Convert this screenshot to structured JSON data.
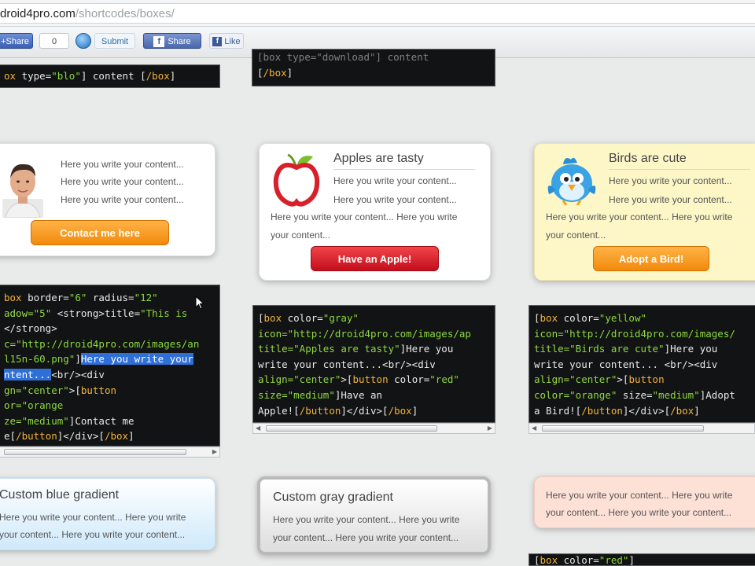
{
  "browser": {
    "url_host": "droid4pro.com",
    "url_path": "/shortcodes/boxes/"
  },
  "social": {
    "share": "+Share",
    "count": "0",
    "submit": "Submit",
    "fb_share": "Share",
    "like": "Like",
    "fb_glyph": "f"
  },
  "code_top_left": {
    "tag_open": "ox",
    "attr": " type=",
    "value": "\"blo\"",
    "content": "] content [",
    "tag_close": "/box",
    "end": "]"
  },
  "code_top_middle": {
    "line1": "[box type=\"download\"] content",
    "tag_open": "[",
    "tag_close": "/box",
    "end": "]"
  },
  "box_person": {
    "line1": "Here you write your content...",
    "line2": "Here you write your content...",
    "line3": "Here you write your content...",
    "button": "Contact me here"
  },
  "box_apple": {
    "title": "Apples are tasty",
    "line1": "Here you write your content...",
    "line2": "Here you write your content...",
    "line3": "Here you write your content... Here you write",
    "line4": "your content...",
    "button": "Have an Apple!"
  },
  "box_bird": {
    "title": "Birds are cute",
    "line1": "Here you write your content...",
    "line2": "Here you write your content...",
    "line3": "Here you write your content... Here you write",
    "line4": "your content...",
    "button": "Adopt a Bird!"
  },
  "code_left": {
    "l1a": "box",
    "l1b": " border=",
    "l1c": "\"6\"",
    "l1d": " radius=",
    "l1e": "\"12\"",
    "l2a": "adow=",
    "l2b": "\"5\"",
    "l2c": " <strong>title=",
    "l2d": "\"This is",
    "l3": "</strong>",
    "l4a": "c=",
    "l4b": "\"http://droid4pro.com/images/an",
    "l5a": "l15n-60.png\"",
    "l5b": "]",
    "l5c": "Here you write your",
    "l6a": "ntent...",
    "l6b": "<br/><div",
    "l7a": "gn=",
    "l7b": "\"center\"",
    "l7c": ">[",
    "l7d": "button",
    "l8a": "or=",
    "l8b": "\"orange",
    "l9a": "ze=",
    "l9b": "\"medium\"",
    "l9c": "]Contact me",
    "l10a": "e[",
    "l10b": "/button",
    "l10c": "]</div>[",
    "l10d": "/box",
    "l10e": "]"
  },
  "code_middle": {
    "l1a": "[",
    "l1b": "box",
    "l1c": " color=",
    "l1d": "\"gray\"",
    "l2a": "icon=",
    "l2b": "\"http://droid4pro.com/images/ap",
    "l3a": "title=",
    "l3b": "\"Apples are tasty\"",
    "l3c": "]Here you",
    "l4": "write your content...<br/><div",
    "l5a": "align=",
    "l5b": "\"center\"",
    "l5c": ">[",
    "l5d": "button",
    "l5e": " color=",
    "l5f": "\"red\"",
    "l6a": "size=",
    "l6b": "\"medium\"",
    "l6c": "]Have an",
    "l7a": "Apple![",
    "l7b": "/button",
    "l7c": "]</div>[",
    "l7d": "/box",
    "l7e": "]"
  },
  "code_right": {
    "l1a": "[",
    "l1b": "box",
    "l1c": " color=",
    "l1d": "\"yellow\"",
    "l2a": "icon=",
    "l2b": "\"http://droid4pro.com/images/",
    "l3a": "title=",
    "l3b": "\"Birds are cute\"",
    "l3c": "]Here you",
    "l4": "write your content... <br/><div",
    "l5a": "align=",
    "l5b": "\"center\"",
    "l5c": ">[",
    "l5d": "button",
    "l6a": "color=",
    "l6b": "\"orange\"",
    "l6c": " size=",
    "l6d": "\"medium\"",
    "l6e": "]Adopt",
    "l7a": "a Bird![",
    "l7b": "/button",
    "l7c": "]</div>[",
    "l7d": "/box",
    "l7e": "]"
  },
  "box_blue": {
    "title": "Custom blue gradient",
    "line1": "Here you write your content... Here you write",
    "line2": "your content... Here you write your content..."
  },
  "box_gray": {
    "title": "Custom gray gradient",
    "line1": "Here you write your content... Here you write",
    "line2": "your content... Here you write your content..."
  },
  "box_pink": {
    "line1": "Here you write your content... Here you write",
    "line2": "your content... Here you write your content..."
  },
  "code_bottom_right": {
    "l1a": "[",
    "l1b": "box",
    "l1c": " color=",
    "l1d": "\"red\"",
    "l1e": "]"
  },
  "colors": {
    "code_bg": "#121314",
    "code_tag": "#f3b33d",
    "code_string": "#8bd93f",
    "orange_button": "#f28a0c",
    "red_button": "#c30e1c",
    "facebook_blue": "#3b5998",
    "selection": "#2f6fd8"
  }
}
